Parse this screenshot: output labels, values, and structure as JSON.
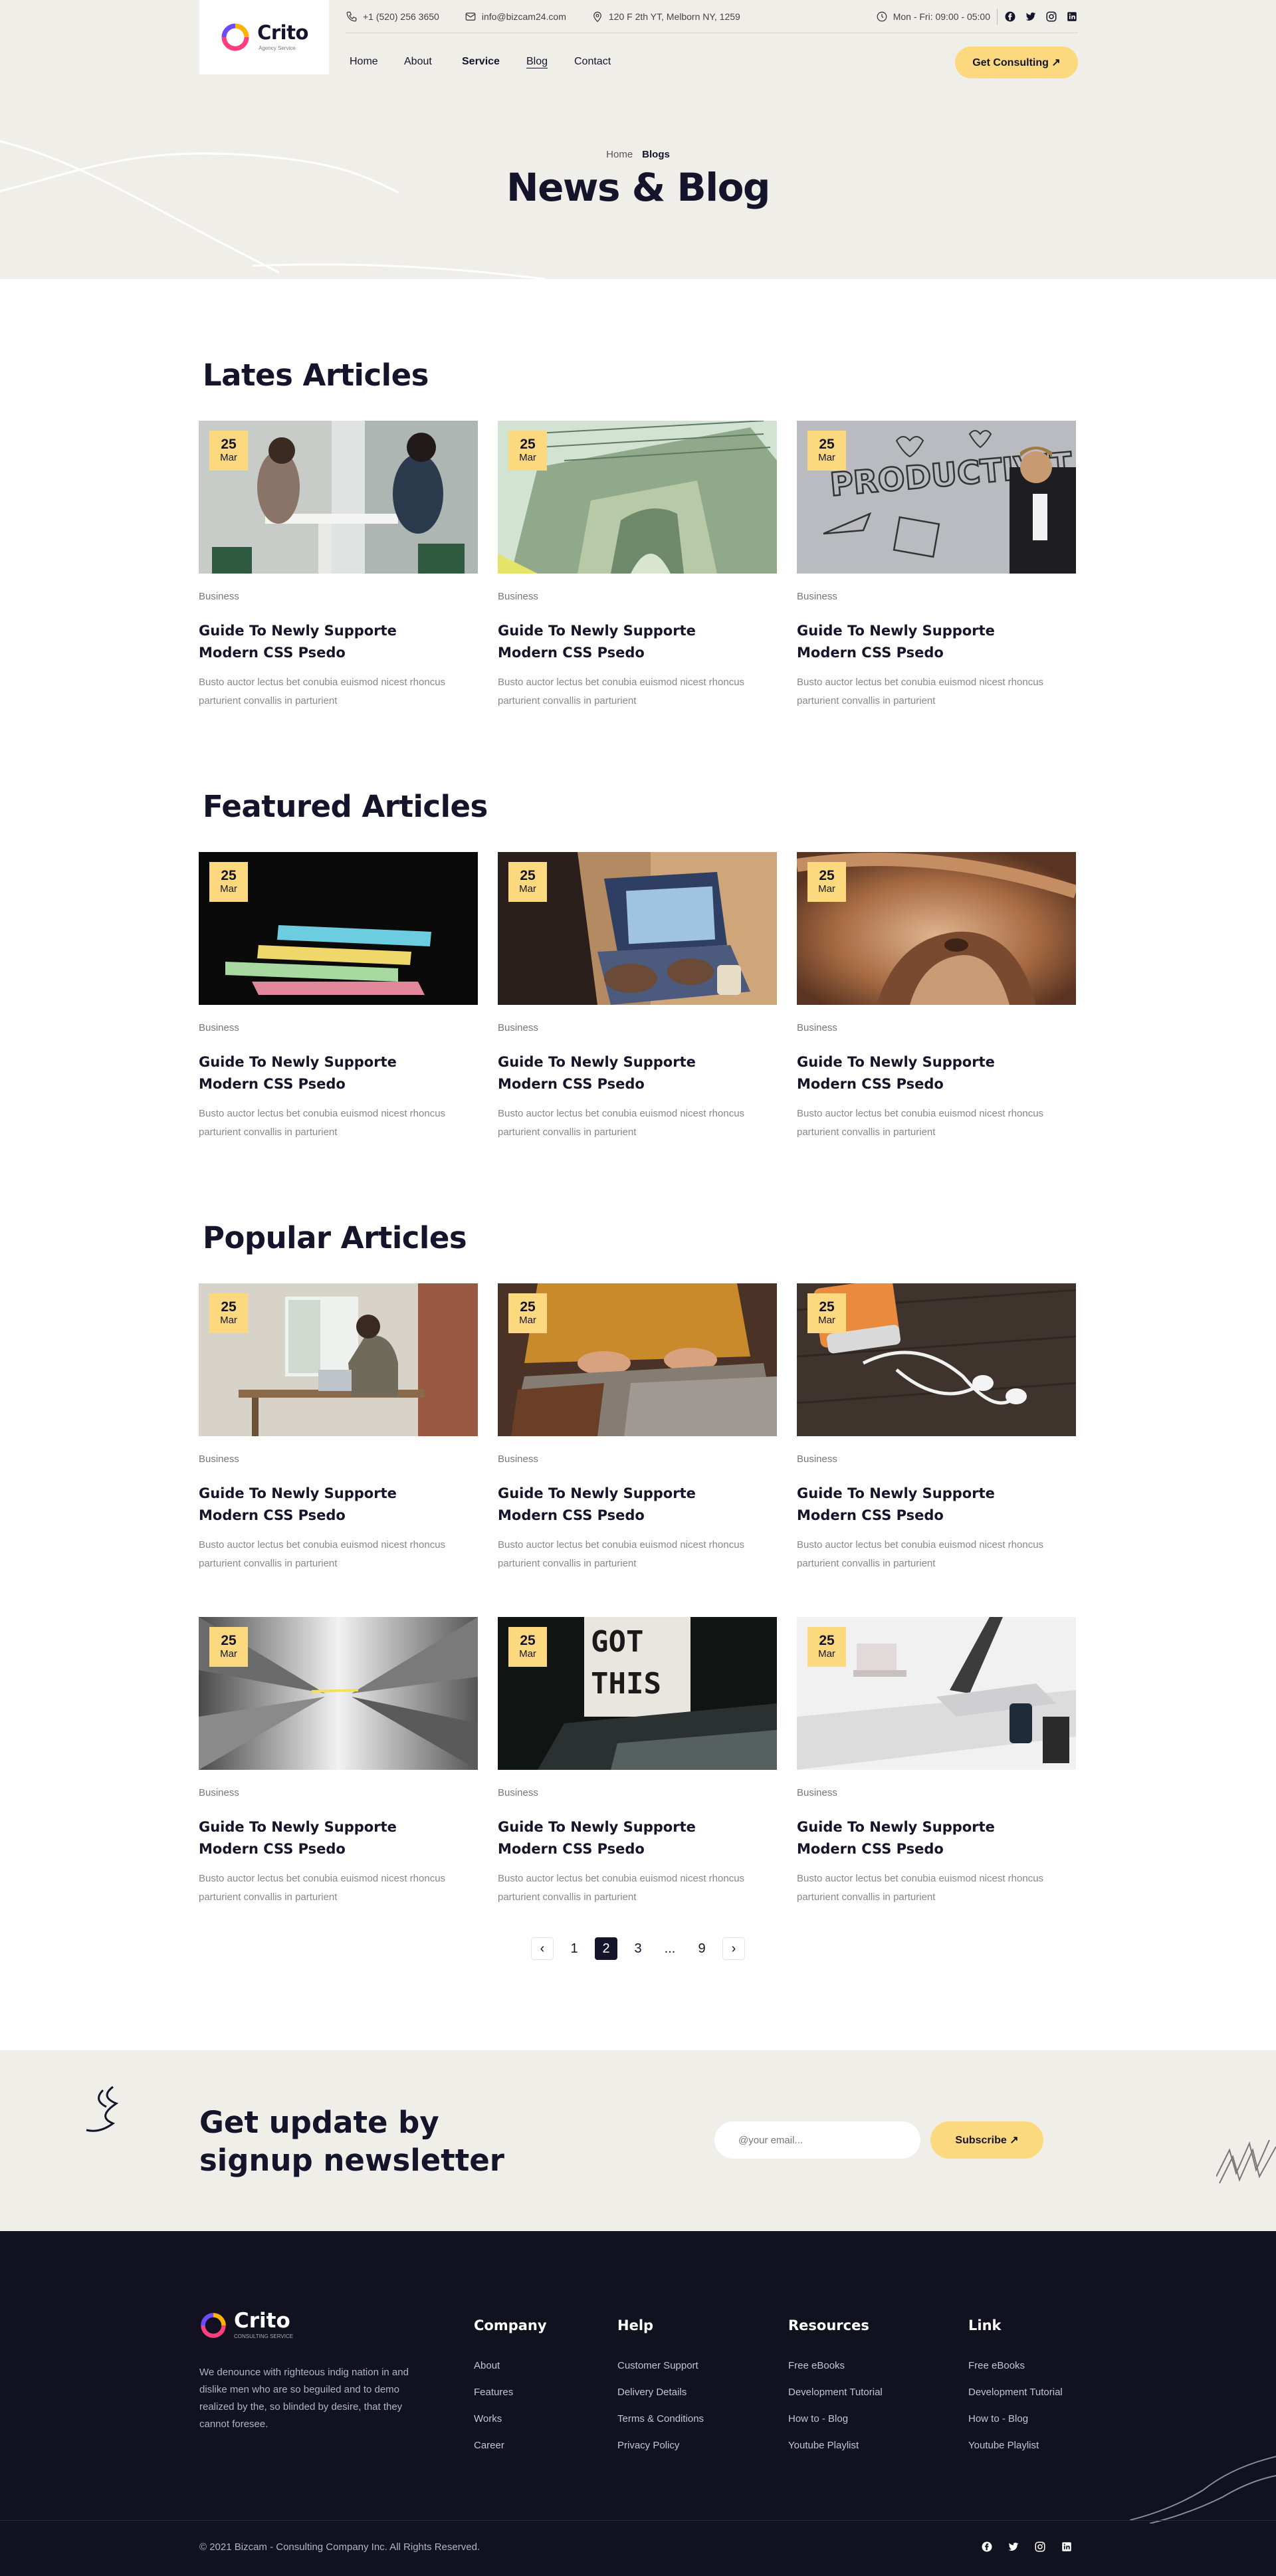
{
  "brand": {
    "name": "Crito",
    "tagline": "Agency Service"
  },
  "topbar": {
    "phone": "+1 (520) 256 3650",
    "email": "info@bizcam24.com",
    "address": "120 F 2th YT, Melborn NY, 1259",
    "hours": "Mon - Fri: 09:00 - 05:00",
    "socials": [
      "facebook-icon",
      "twitter-icon",
      "instagram-icon",
      "linkedin-icon"
    ]
  },
  "nav": {
    "items": [
      "Home",
      "About",
      "Service",
      "Blog",
      "Contact"
    ],
    "active_bold": "Service",
    "current": "Blog",
    "cta": "Get Consulting ↗"
  },
  "hero": {
    "breadcrumb": [
      "Home",
      "Blogs"
    ],
    "title": "News & Blog"
  },
  "sections": [
    {
      "title": "Lates Articles"
    },
    {
      "title": "Featured Articles"
    },
    {
      "title": "Popular Articles"
    }
  ],
  "article": {
    "day": "25",
    "month": "Mar",
    "category": "Business",
    "title": "Guide To Newly Supporte Modern CSS Psedo",
    "excerpt": "Busto auctor lectus bet conubia euismod nicest rhoncus parturient convallis in parturient"
  },
  "images": {
    "latest": [
      "meeting-photo",
      "banknote-photo",
      "productivity-photo"
    ],
    "featured": [
      "sticky-notes-photo",
      "laptop-typing-photo",
      "wood-curve-photo"
    ],
    "popular_row1": [
      "man-at-desk-photo",
      "sweater-laptop-photo",
      "phone-earphones-photo"
    ],
    "popular_row2": [
      "tunnel-photo",
      "got-this-sign-photo",
      "desk-laptop-photo"
    ]
  },
  "pagination": {
    "prev": "‹",
    "pages": [
      "1",
      "2",
      "3",
      "...",
      "9"
    ],
    "current": "2",
    "next": "›"
  },
  "newsletter": {
    "title": "Get update by signup newsletter",
    "placeholder": "@your email...",
    "button": "Subscribe ↗"
  },
  "footer": {
    "brand": {
      "name": "Crito",
      "tagline": "CONSULTING SERVICE"
    },
    "about": "We denounce with righteous indig nation in and dislike men who are so beguiled and to demo realized by the, so blinded by desire, that they cannot foresee.",
    "columns": [
      {
        "title": "Company",
        "links": [
          "About",
          "Features",
          "Works",
          "Career"
        ]
      },
      {
        "title": "Help",
        "links": [
          "Customer Support",
          "Delivery Details",
          "Terms & Conditions",
          "Privacy Policy"
        ]
      },
      {
        "title": "Resources",
        "links": [
          "Free eBooks",
          "Development Tutorial",
          "How to - Blog",
          "Youtube Playlist"
        ]
      },
      {
        "title": "Link",
        "links": [
          "Free eBooks",
          "Development Tutorial",
          "How to - Blog",
          "Youtube Playlist"
        ]
      }
    ],
    "copyright": "© 2021 Bizcam - Consulting Company Inc. All Rights Reserved."
  },
  "colors": {
    "accent": "#fcd97e",
    "dark": "#14142b",
    "footer_bg": "#11111f",
    "hero_bg": "#f0eee9"
  }
}
